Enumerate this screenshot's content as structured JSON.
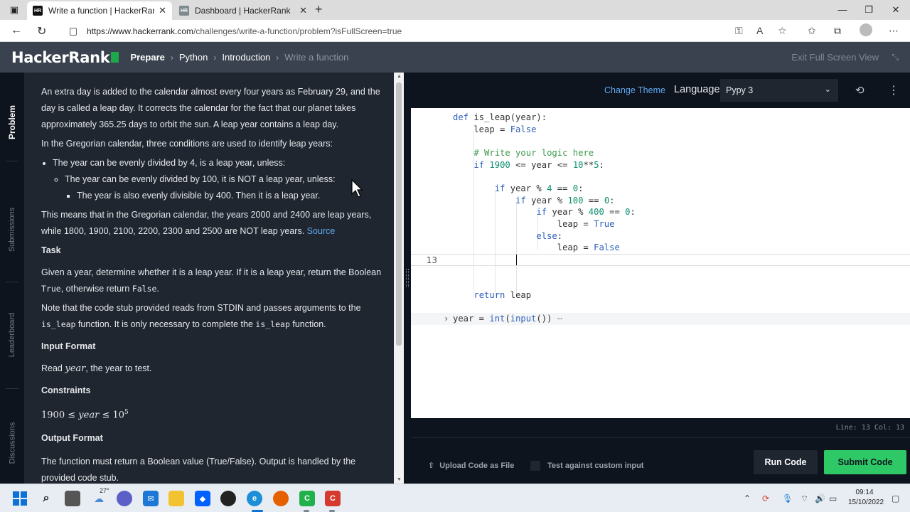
{
  "browser": {
    "tabs": [
      {
        "title": "Write a function | HackerRank",
        "favicon": "HR",
        "active": true
      },
      {
        "title": "Dashboard | HackerRank",
        "favicon": "HR",
        "active": false
      }
    ],
    "url_host": "https://www.hackerrank.com",
    "url_path": "/challenges/write-a-function/problem?isFullScreen=true"
  },
  "header": {
    "logo": "HackerRank",
    "breadcrumbs": [
      "Prepare",
      "Python",
      "Introduction",
      "Write a function"
    ],
    "exit_fullscreen": "Exit Full Screen View"
  },
  "side_tabs": [
    "Problem",
    "Submissions",
    "Leaderboard",
    "Discussions"
  ],
  "problem": {
    "intro": "An extra day is added to the calendar almost every four years as February 29, and the day is called a leap day. It corrects the calendar for the fact that our planet takes approximately 365.25 days to orbit the sun. A leap year contains a leap day.",
    "gregorian": "In the Gregorian calendar, three conditions are used to identify leap years:",
    "cond1": "The year can be evenly divided by 4, is a leap year, unless:",
    "cond2": "The year can be evenly divided by 100, it is NOT a leap year, unless:",
    "cond3": "The year is also evenly divisible by 400. Then it is a leap year.",
    "means": "This means that in the Gregorian calendar, the years 2000 and 2400 are leap years, while 1800, 1900, 2100, 2200, 2300 and 2500 are NOT leap years.",
    "source": "Source",
    "task_heading": "Task",
    "task_a": "Given a year, determine whether it is a leap year. If it is a leap year, return the Boolean",
    "task_true": "True",
    "task_b": ", otherwise return",
    "task_false": "False",
    "task_c": ".",
    "note_a": "Note that the code stub provided reads from STDIN and passes arguments to the",
    "note_code1": "is_leap",
    "note_b": "function. It is only necessary to complete the",
    "note_code2": "is_leap",
    "note_c": "function.",
    "input_heading": "Input Format",
    "input_a": "Read",
    "input_var": "year",
    "input_b": ", the year to test.",
    "constraints_heading": "Constraints",
    "constraint_low": "1900",
    "constraint_le": "≤",
    "constraint_var": "year",
    "constraint_base": "10",
    "constraint_exp": "5",
    "output_heading": "Output Format",
    "output_text": "The function must return a Boolean value (True/False). Output is handled by the provided code stub."
  },
  "editor": {
    "change_theme": "Change Theme",
    "language_label": "Language",
    "language_value": "Pypy 3",
    "current_line_number": "13",
    "status": "Line: 13 Col: 13"
  },
  "actions": {
    "upload": "Upload Code as File",
    "custom_input": "Test against custom input",
    "run": "Run Code",
    "submit": "Submit Code"
  },
  "taskbar": {
    "temperature": "27°",
    "time": "09:14",
    "date": "15/10/2022"
  },
  "colors": {
    "hr_header": "#39424e",
    "problem_bg": "#1f2630",
    "dark_bg": "#0e141e",
    "submit_green": "#2ec866",
    "link_blue": "#5fa8f0"
  }
}
